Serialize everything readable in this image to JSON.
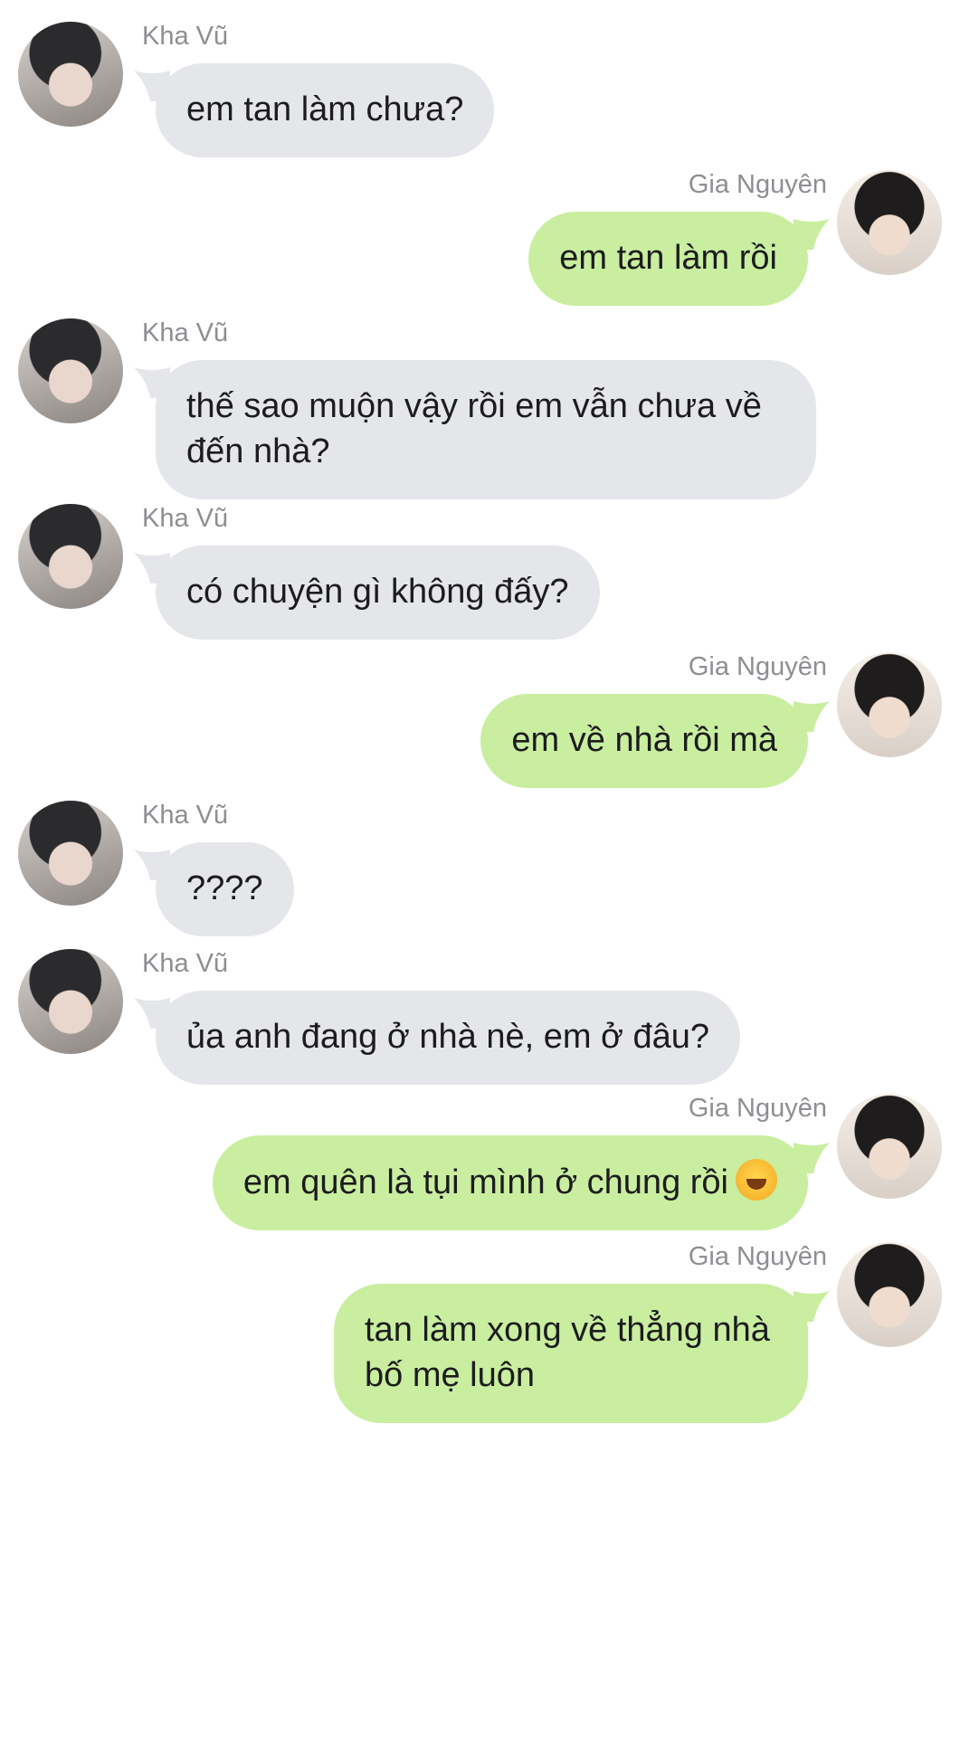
{
  "names": {
    "left": "Kha Vũ",
    "right": "Gia Nguyên"
  },
  "messages": [
    {
      "side": "left",
      "sender": "Kha Vũ",
      "text": "em tan làm chưa?"
    },
    {
      "side": "right",
      "sender": "Gia Nguyên",
      "text": "em tan làm rồi"
    },
    {
      "side": "left",
      "sender": "Kha Vũ",
      "text": "thế sao muộn vậy rồi em vẫn chưa về đến nhà?"
    },
    {
      "side": "left",
      "sender": "Kha Vũ",
      "text": "có chuyện gì không đấy?"
    },
    {
      "side": "right",
      "sender": "Gia Nguyên",
      "text": "em về nhà rồi mà"
    },
    {
      "side": "left",
      "sender": "Kha Vũ",
      "text": "????"
    },
    {
      "side": "left",
      "sender": "Kha Vũ",
      "text": "ủa anh đang ở nhà nè, em ở đâu?"
    },
    {
      "side": "right",
      "sender": "Gia Nguyên",
      "text": "em quên là tụi mình ở chung rồi",
      "emoji": "rolling-on-floor-laughing-emoji"
    },
    {
      "side": "right",
      "sender": "Gia Nguyên",
      "text": "tan làm xong về thẳng nhà bố mẹ luôn"
    }
  ],
  "colors": {
    "incoming_bubble": "#e5e6ea",
    "outgoing_bubble": "#c9eea0",
    "name_text": "#8e8e93",
    "message_text": "#1c1c1e"
  }
}
